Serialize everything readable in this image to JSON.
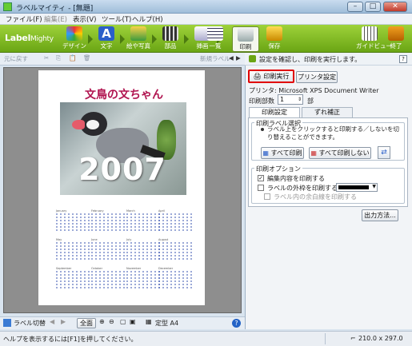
{
  "window": {
    "title": "ラベルマイティ - [無題]",
    "minimize": "–",
    "maximize": "□",
    "close": "✕"
  },
  "menu": [
    "ファイル(F)",
    "編集(E)",
    "表示(V)",
    "ツール(T)",
    "ヘルプ(H)"
  ],
  "ribbon": {
    "logo_main": "Label",
    "logo_sub": "Mighty",
    "tools": [
      "デザイン",
      "文字",
      "絵や写真",
      "部品",
      "挿画",
      "一覧",
      "印刷",
      "保存"
    ],
    "right_tools": [
      "ガイドビュー",
      "終了"
    ]
  },
  "left_toolbar": {
    "undo": "元に戻す",
    "save_as": "新規ラベル",
    "nav_prev": "◀",
    "nav_next": "▶"
  },
  "canvas": {
    "calendar_title": "文鳥の文ちゃん",
    "year": "2007",
    "months": [
      "January",
      "February",
      "March",
      "April",
      "May",
      "June",
      "July",
      "August",
      "September",
      "October",
      "November",
      "December"
    ]
  },
  "left_bottom": {
    "label_list": "ラベル切替",
    "fit": "全面",
    "paper": "定型 A4"
  },
  "right_panel": {
    "header_text": "設定を確認し、印刷を実行します。",
    "help": "?",
    "print_exec": "印刷実行",
    "printer_setting": "プリンタ設定",
    "printer_name": "プリンタ: Microsoft XPS Document Writer",
    "copies_label": "印刷部数",
    "copies_value": "1",
    "copies_unit": "部",
    "tabs": [
      "印刷設定",
      "ずれ補正"
    ],
    "label_select_title": "印刷ラベル選択",
    "label_select_desc": "ラベル上をクリックすると印刷する／しないを切り替えることができます。",
    "print_all": "すべて印刷",
    "print_none": "すべて印刷しない",
    "options_title": "印刷オプション",
    "opt_edit": "編集内容を印刷する",
    "opt_frame": "ラベルの外枠を印刷する",
    "opt_frame_color": "#000000",
    "opt_grid": "ラベル内の余白線を印刷する",
    "output_method": "出力方法..."
  },
  "status": {
    "help_text": "ヘルプを表示するには[F1]を押してください。",
    "size": "210.0 x 297.0"
  }
}
